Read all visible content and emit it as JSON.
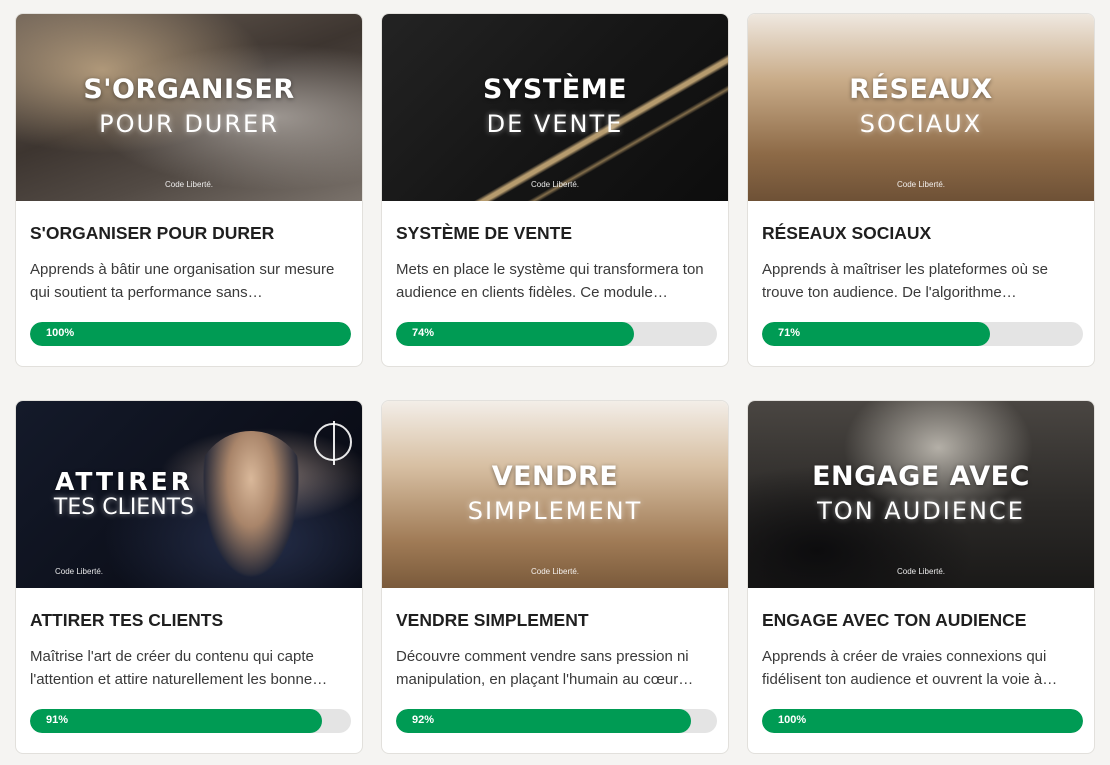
{
  "brand": "Code Liberté.",
  "colors": {
    "progress_fill": "#009b54",
    "progress_track": "#e4e4e4"
  },
  "courses": [
    {
      "thumb_title": "S'ORGANISER",
      "thumb_sub": "POUR DURER",
      "title": "S'ORGANISER POUR DURER",
      "description": "Apprends à bâtir une organisation sur mesure qui soutient ta performance sans…",
      "progress_label": "100%",
      "progress": 1.0
    },
    {
      "thumb_title": "SYSTÈME",
      "thumb_sub": "DE VENTE",
      "title": "SYSTÈME DE VENTE",
      "description": "Mets en place le système qui transformera ton audience en clients fidèles. Ce module…",
      "progress_label": "74%",
      "progress": 0.74
    },
    {
      "thumb_title": "RÉSEAUX",
      "thumb_sub": "SOCIAUX",
      "title": "RÉSEAUX SOCIAUX",
      "description": "Apprends à maîtriser les plateformes où se trouve ton audience. De l'algorithme…",
      "progress_label": "71%",
      "progress": 0.71
    },
    {
      "thumb_title": "ATTIRER",
      "thumb_sub": "TES CLIENTS",
      "title": "ATTIRER TES CLIENTS",
      "description": "Maîtrise l'art de créer du contenu qui capte l'attention et attire naturellement les bonne…",
      "progress_label": "91%",
      "progress": 0.91
    },
    {
      "thumb_title": "VENDRE",
      "thumb_sub": "SIMPLEMENT",
      "title": "VENDRE SIMPLEMENT",
      "description": "Découvre comment vendre sans pression ni manipulation, en plaçant l'humain au cœur…",
      "progress_label": "92%",
      "progress": 0.92
    },
    {
      "thumb_title": "ENGAGE AVEC",
      "thumb_sub": "TON AUDIENCE",
      "title": "ENGAGE AVEC TON AUDIENCE",
      "description": "Apprends à créer de vraies connexions qui fidélisent ton audience et ouvrent la voie à…",
      "progress_label": "100%",
      "progress": 1.0
    }
  ]
}
